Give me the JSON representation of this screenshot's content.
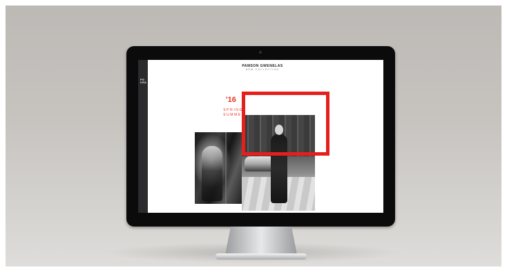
{
  "scene": {
    "background_color": "#c4c1bd",
    "highlight_color": "#e41f1c"
  },
  "website": {
    "side_rail": {
      "logo_lines": [
        "PG",
        "USA"
      ]
    },
    "brand": {
      "name": "PAMSON GWENELAS",
      "subtitle": "NEW COLLECTION"
    },
    "hero": {
      "year": "'16",
      "season_line_1": "SPRING/",
      "season_line_2": "SUMMER",
      "accent_color": "#e8321f"
    },
    "photos": [
      {
        "icon": "fashion-photo-icon"
      },
      {
        "icon": "street-fashion-photo-icon"
      }
    ]
  }
}
